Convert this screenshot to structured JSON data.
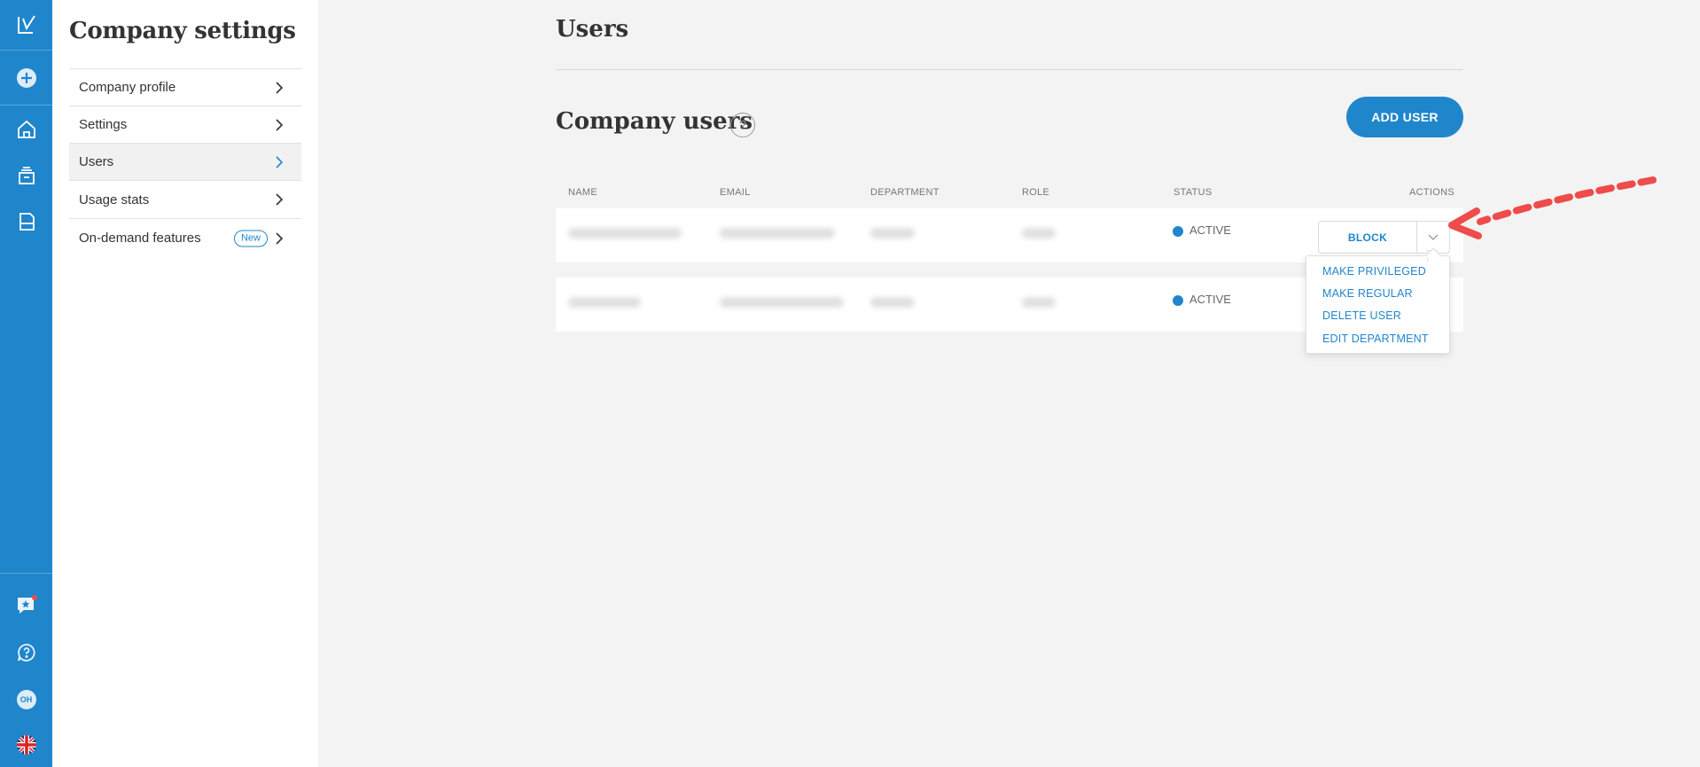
{
  "sidebar": {
    "title": "Company settings",
    "items": [
      {
        "label": "Company profile"
      },
      {
        "label": "Settings"
      },
      {
        "label": "Users"
      },
      {
        "label": "Usage stats"
      },
      {
        "label": "On-demand features",
        "badge": "New"
      }
    ]
  },
  "main": {
    "title": "Users",
    "section_title": "Company users",
    "help_label": "?",
    "add_user_label": "ADD USER",
    "columns": [
      "NAME",
      "EMAIL",
      "DEPARTMENT",
      "ROLE",
      "STATUS",
      "ACTIONS"
    ],
    "rows": [
      {
        "status": "ACTIVE"
      },
      {
        "status": "ACTIVE"
      }
    ],
    "block_label": "BLOCK",
    "menu": [
      "MAKE PRIVILEGED",
      "MAKE REGULAR",
      "DELETE USER",
      "EDIT DEPARTMENT"
    ]
  },
  "rail": {
    "avatar_initials": "OH",
    "icons": [
      "logo-icon",
      "add-icon",
      "home-icon",
      "inbox-icon",
      "store-icon",
      "feedback-icon",
      "help-icon",
      "avatar",
      "language-flag-icon"
    ]
  },
  "colors": {
    "accent": "#1f86cc",
    "annotation_arrow": "#ef4b4b"
  }
}
